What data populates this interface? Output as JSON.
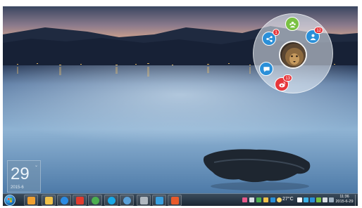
{
  "calendar_widget": {
    "day": "29",
    "year_month": "2015-6",
    "corner_mark": "⌄"
  },
  "radial_menu": {
    "buttons": [
      {
        "name": "apps-button",
        "icon": "group-icon",
        "color": "#7ac143",
        "badge": ""
      },
      {
        "name": "share-button",
        "icon": "share-icon",
        "color": "#2a8fd8",
        "badge": "1"
      },
      {
        "name": "contacts-button",
        "icon": "contacts-icon",
        "color": "#2a8fd8",
        "badge": "12"
      },
      {
        "name": "chat-button",
        "icon": "chat-bubble-icon",
        "color": "#2a8fd8",
        "badge": ""
      },
      {
        "name": "weibo-button",
        "icon": "weibo-icon",
        "color": "#e6363b",
        "badge": "13"
      }
    ],
    "avatar": "lion-avatar"
  },
  "taskbar": {
    "apps": [
      {
        "name": "media-player",
        "icon": "media-player-icon",
        "color": "#f0a030"
      },
      {
        "name": "file-explorer",
        "icon": "folder-icon",
        "color": "#f1c24b"
      },
      {
        "name": "internet-explorer",
        "icon": "ie-icon",
        "color": "#2b8be3"
      },
      {
        "name": "qq",
        "icon": "qq-penguin-icon",
        "color": "#e23b2e"
      },
      {
        "name": "chrome",
        "icon": "chrome-icon",
        "color": "#4caf50"
      },
      {
        "name": "skype",
        "icon": "skype-icon",
        "color": "#18a8e6"
      },
      {
        "name": "network-app",
        "icon": "globe-icon",
        "color": "#5aa0d8"
      },
      {
        "name": "tools-app",
        "icon": "gear-icon",
        "color": "#b0b8c0"
      },
      {
        "name": "save-app",
        "icon": "floppy-icon",
        "color": "#39a0e0"
      },
      {
        "name": "browser-app",
        "icon": "browser-icon",
        "color": "#e85a2a"
      }
    ],
    "tray": {
      "temperature": "27°C",
      "time": "11:36",
      "date": "2015-6-29"
    }
  }
}
